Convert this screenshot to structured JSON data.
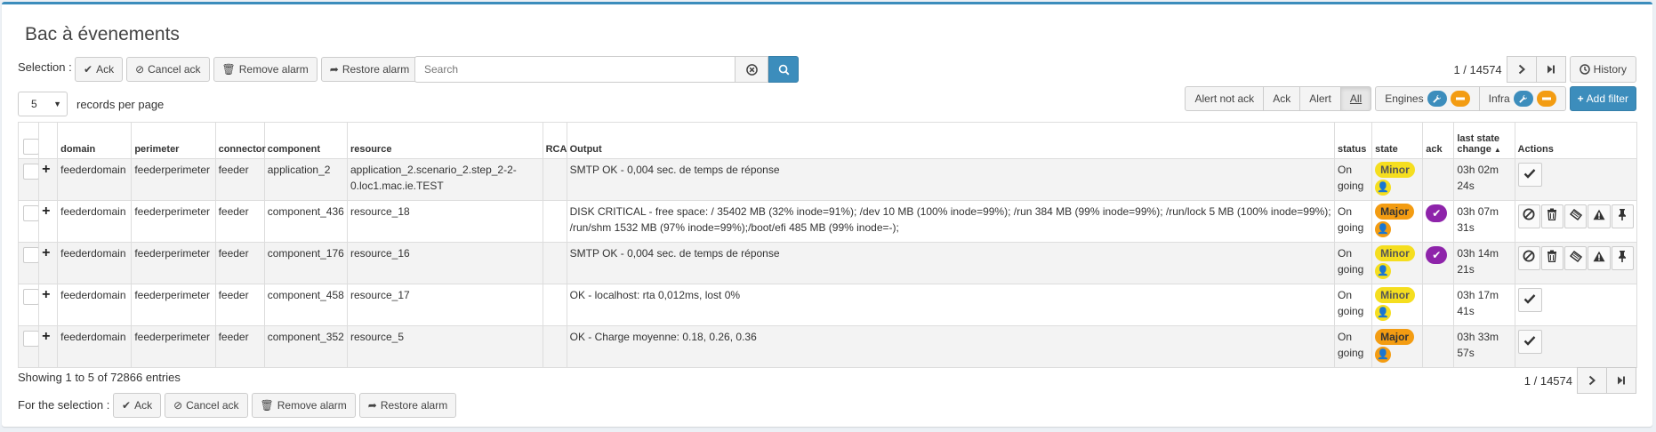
{
  "page": {
    "title": "Bac à évenements"
  },
  "selection": {
    "label": "Selection :",
    "ack": "Ack",
    "cancel_ack": "Cancel ack",
    "remove_alarm": "Remove alarm",
    "restore_alarm": "Restore alarm"
  },
  "search": {
    "placeholder": "Search"
  },
  "pager_top": {
    "text": "1 / 14574",
    "history": "History"
  },
  "records": {
    "value": "5",
    "label": "records per page"
  },
  "filters": {
    "alert_not_ack": "Alert not ack",
    "ack": "Ack",
    "alert": "Alert",
    "all": "All",
    "engines": "Engines",
    "infra": "Infra",
    "add_filter": "Add filter"
  },
  "columns": [
    "domain",
    "perimeter",
    "connector",
    "component",
    "resource",
    "RCA",
    "Output",
    "status",
    "state",
    "ack",
    "last state change",
    "Actions"
  ],
  "rows": [
    {
      "domain": "feederdomain",
      "perimeter": "feederperimeter",
      "connector": "feeder",
      "component": "application_2",
      "resource": "application_2.scenario_2.step_2-2-0.loc1.mac.ie.TEST",
      "output": "SMTP OK - 0,004 sec. de temps de réponse",
      "status": "On going",
      "state": "Minor",
      "acked": false,
      "last_change": "03h 02m 24s",
      "actions": "ack"
    },
    {
      "domain": "feederdomain",
      "perimeter": "feederperimeter",
      "connector": "feeder",
      "component": "component_436",
      "resource": "resource_18",
      "output": "DISK CRITICAL - free space: / 35402 MB (32% inode=91%); /dev 10 MB (100% inode=99%); /run 384 MB (99% inode=99%); /run/lock 5 MB (100% inode=99%); /run/shm 1532 MB (97% inode=99%);/boot/efi 485 MB (99% inode=-);",
      "status": "On going",
      "state": "Major",
      "acked": true,
      "last_change": "03h 07m 31s",
      "actions": "full"
    },
    {
      "domain": "feederdomain",
      "perimeter": "feederperimeter",
      "connector": "feeder",
      "component": "component_176",
      "resource": "resource_16",
      "output": "SMTP OK - 0,004 sec. de temps de réponse",
      "status": "On going",
      "state": "Minor",
      "acked": true,
      "last_change": "03h 14m 21s",
      "actions": "full"
    },
    {
      "domain": "feederdomain",
      "perimeter": "feederperimeter",
      "connector": "feeder",
      "component": "component_458",
      "resource": "resource_17",
      "output": "OK - localhost: rta 0,012ms, lost 0%",
      "status": "On going",
      "state": "Minor",
      "acked": false,
      "last_change": "03h 17m 41s",
      "actions": "ack"
    },
    {
      "domain": "feederdomain",
      "perimeter": "feederperimeter",
      "connector": "feeder",
      "component": "component_352",
      "resource": "resource_5",
      "output": "OK - Charge moyenne: 0.18, 0.26, 0.36",
      "status": "On going",
      "state": "Major",
      "acked": false,
      "last_change": "03h 33m 57s",
      "actions": "ack"
    }
  ],
  "footer": {
    "showing": "Showing 1 to 5 of 72866 entries",
    "for_selection": "For the selection :",
    "pager_text": "1 / 14574"
  },
  "colors": {
    "accent": "#3c8dbc",
    "minor": "#f5de1f",
    "major": "#f39c12",
    "ack": "#8e24aa"
  }
}
